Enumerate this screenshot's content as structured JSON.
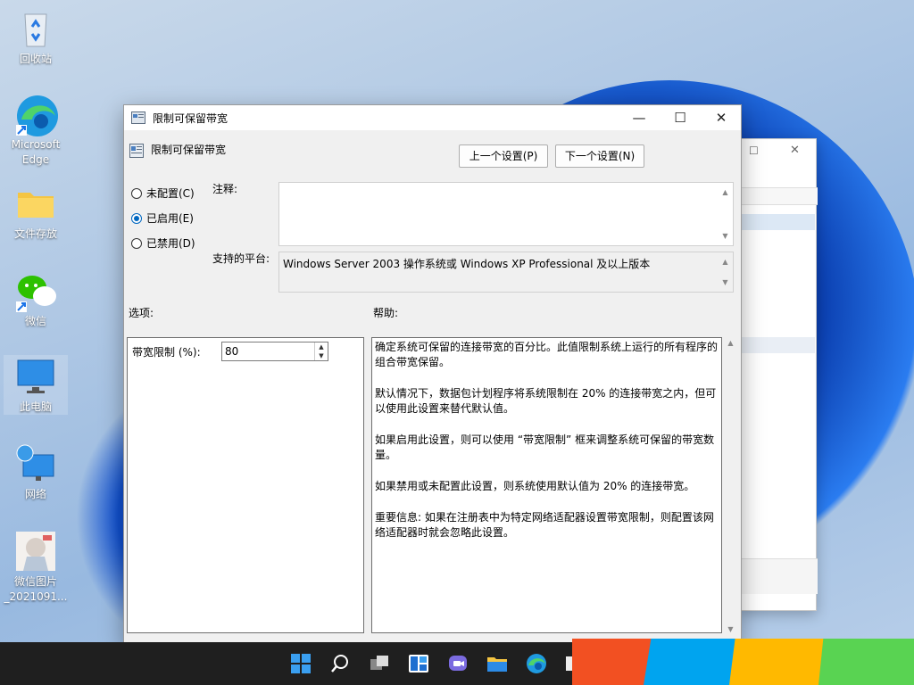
{
  "desktop": {
    "icons": [
      {
        "label": "回收站"
      },
      {
        "label": "Microsoft Edge"
      },
      {
        "label": "文件存放"
      },
      {
        "label": "微信"
      },
      {
        "label": "此电脑"
      },
      {
        "label": "网络"
      },
      {
        "label": "微信图片_2021091..."
      }
    ]
  },
  "dialog": {
    "window_title": "限制可保留带宽",
    "policy_name": "限制可保留带宽",
    "prev_button": "上一个设置(P)",
    "next_button": "下一个设置(N)",
    "radio": {
      "not_configured": "未配置(C)",
      "enabled": "已启用(E)",
      "disabled": "已禁用(D)",
      "selected": "enabled"
    },
    "comment_label": "注释:",
    "comment_value": "",
    "platform_label": "支持的平台:",
    "platform_value": "Windows Server 2003 操作系统或 Windows XP Professional 及以上版本",
    "options_label": "选项:",
    "help_label": "帮助:",
    "bandwidth_label": "带宽限制 (%):",
    "bandwidth_value": "80",
    "help_paragraphs": [
      "确定系统可保留的连接带宽的百分比。此值限制系统上运行的所有程序的组合带宽保留。",
      "默认情况下，数据包计划程序将系统限制在 20% 的连接带宽之内，但可以使用此设置来替代默认值。",
      "如果启用此设置，则可以使用 “带宽限制” 框来调整系统可保留的带宽数量。",
      "如果禁用或未配置此设置，则系统使用默认值为 20% 的连接带宽。",
      "重要信息: 如果在注册表中为特定网络适配器设置带宽限制，则配置该网络适配器时就会忽略此设置。"
    ]
  },
  "taskbar": {
    "icons": [
      "start-icon",
      "search-icon",
      "task-view-icon",
      "widgets-icon",
      "chat-icon",
      "file-explorer-icon",
      "edge-icon"
    ]
  },
  "colors": {
    "accent": "#0067c0",
    "block_red": "#f25022",
    "block_blue": "#00a4ef",
    "block_yellow": "#ffb900",
    "block_green": "#7fba00"
  }
}
